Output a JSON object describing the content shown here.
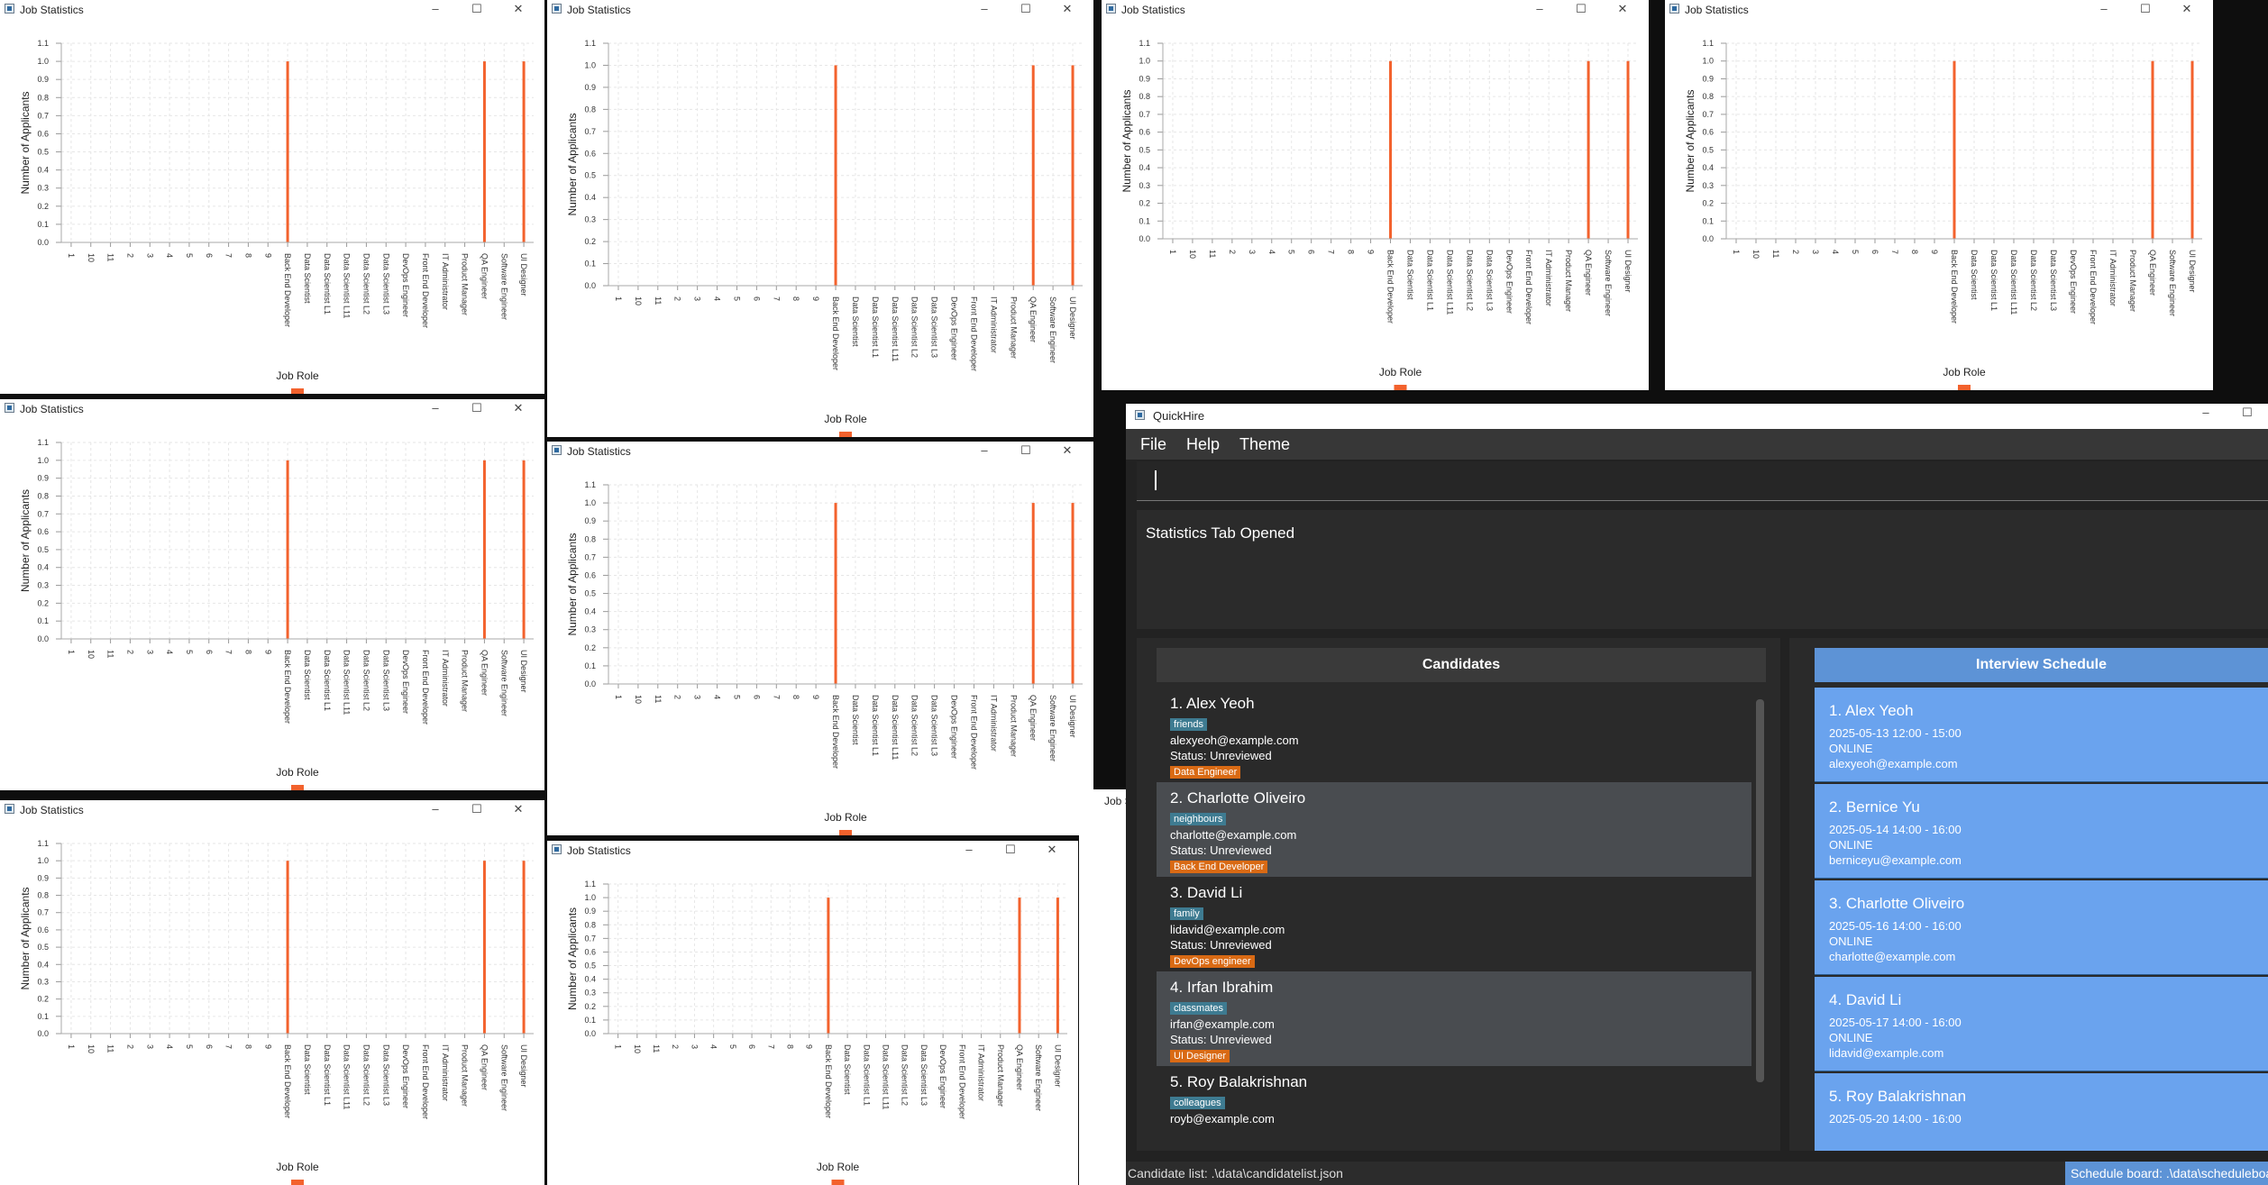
{
  "chart_window": {
    "title": "Job Statistics",
    "controls": {
      "minimize": "–",
      "maximize": "☐",
      "close": "✕"
    }
  },
  "chart_data": {
    "type": "bar",
    "ylabel": "Number of Applicants",
    "xlabel": "Job Role",
    "ylim": [
      0,
      1.1
    ],
    "yticks": [
      "0.0",
      "0.1",
      "0.2",
      "0.3",
      "0.4",
      "0.5",
      "0.6",
      "0.7",
      "0.8",
      "0.9",
      "1.0",
      "1.1"
    ],
    "categories": [
      "1",
      "10",
      "11",
      "2",
      "3",
      "4",
      "5",
      "6",
      "7",
      "8",
      "9",
      "Back End Developer",
      "Data Scientist",
      "Data Scientist L1",
      "Data Scientist L11",
      "Data Scientist L2",
      "Data Scientist L3",
      "DevOps Engineer",
      "Front End Developer",
      "IT Administrator",
      "Product Manager",
      "QA Engineer",
      "Software Engineer",
      "UI Designer"
    ],
    "values": [
      0,
      0,
      0,
      0,
      0,
      0,
      0,
      0,
      0,
      0,
      0,
      1,
      0,
      0,
      0,
      0,
      0,
      0,
      0,
      0,
      0,
      1,
      0,
      1
    ],
    "bar_color": "#f3622d",
    "grid": true,
    "legend": "bottom"
  },
  "quickhire": {
    "title": "QuickHire",
    "menu": [
      "File",
      "Help",
      "Theme"
    ],
    "command_value": "",
    "result": "Statistics Tab Opened",
    "candidates_header": "Candidates",
    "schedule_header": "Interview Schedule",
    "candidates": [
      {
        "name": "1. Alex Yeoh",
        "tag": "friends",
        "email": "alexyeoh@example.com",
        "status": "Status: Unreviewed",
        "role": "Data Engineer"
      },
      {
        "name": "2. Charlotte Oliveiro",
        "tag": "neighbours",
        "email": "charlotte@example.com",
        "status": "Status: Unreviewed",
        "role": "Back End Developer"
      },
      {
        "name": "3. David Li",
        "tag": "family",
        "email": "lidavid@example.com",
        "status": "Status: Unreviewed",
        "role": "DevOps engineer"
      },
      {
        "name": "4. Irfan Ibrahim",
        "tag": "classmates",
        "email": "irfan@example.com",
        "status": "Status: Unreviewed",
        "role": "UI Designer"
      },
      {
        "name": "5. Roy Balakrishnan",
        "tag": "colleagues",
        "email": "royb@example.com",
        "status": "",
        "role": ""
      }
    ],
    "schedule": [
      {
        "name": "1. Alex Yeoh",
        "time": "2025-05-13  12:00 - 15:00",
        "mode": "ONLINE",
        "email": "alexyeoh@example.com"
      },
      {
        "name": "2. Bernice Yu",
        "time": "2025-05-14  14:00 - 16:00",
        "mode": "ONLINE",
        "email": "berniceyu@example.com"
      },
      {
        "name": "3. Charlotte Oliveiro",
        "time": "2025-05-16  14:00 - 16:00",
        "mode": "ONLINE",
        "email": "charlotte@example.com"
      },
      {
        "name": "4. David Li",
        "time": "2025-05-17  14:00 - 16:00",
        "mode": "ONLINE",
        "email": "lidavid@example.com"
      },
      {
        "name": "5. Roy Balakrishnan",
        "time": "2025-05-20  14:00 - 16:00",
        "mode": "",
        "email": ""
      }
    ],
    "status_left": "Candidate list: .\\data\\candidatelist.json",
    "status_right": "Schedule board: .\\data\\scheduleboard.json"
  },
  "partial_window_title": "Job Statistics"
}
